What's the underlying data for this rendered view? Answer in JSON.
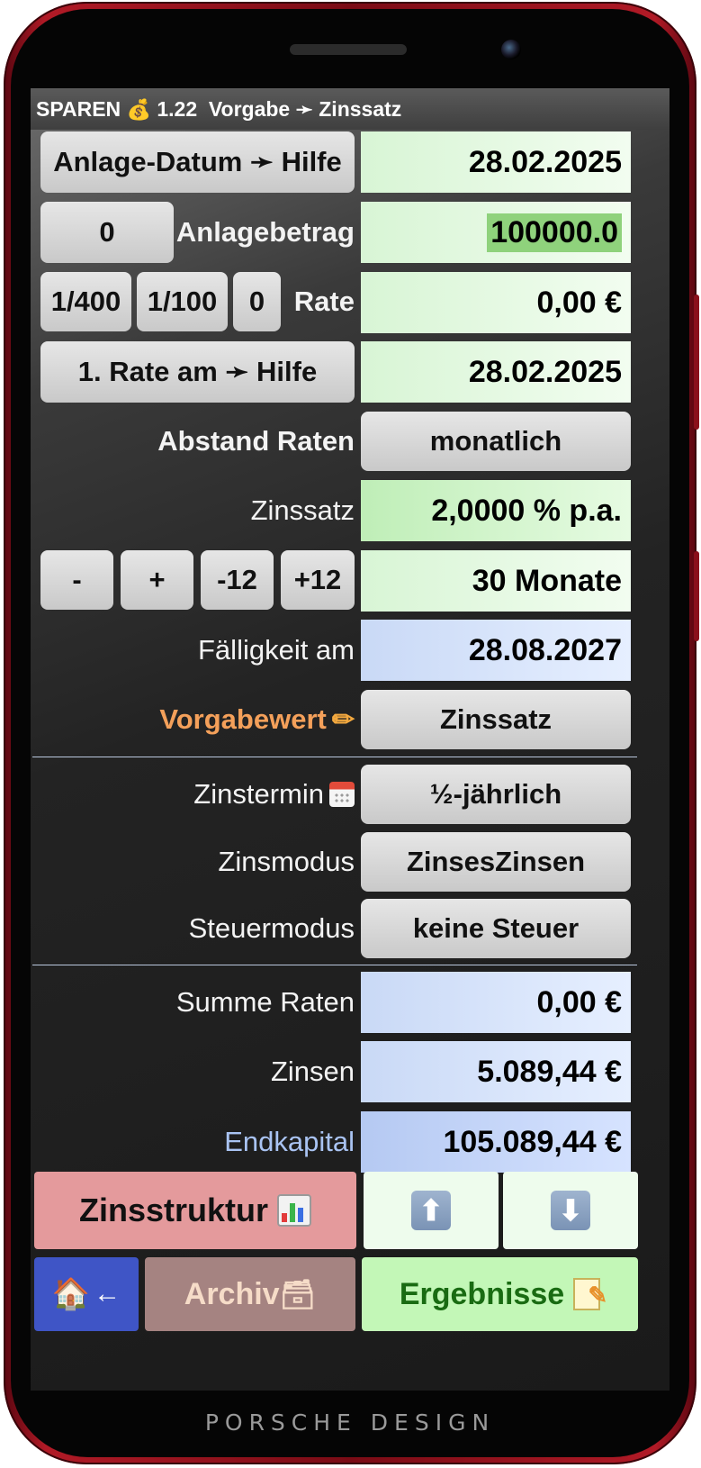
{
  "device": {
    "brand_text": "PORSCHE DESIGN"
  },
  "statusbar": {
    "app": "SPAREN",
    "icon": "money-bag-icon",
    "version": "1.22",
    "mode": "Vorgabe ➛ Zinssatz"
  },
  "rows": {
    "anlage_datum": {
      "button": "Anlage-Datum ➛ Hilfe",
      "value": "28.02.2025"
    },
    "anlagebetrag": {
      "button": "0",
      "label": "Anlagebetrag",
      "value": "100000.0"
    },
    "rate": {
      "btn_a": "1/400",
      "btn_b": "1/100",
      "btn_c": "0",
      "label": "Rate",
      "value": "0,00 €"
    },
    "erste_rate": {
      "button": "1. Rate am ➛ Hilfe",
      "value": "28.02.2025"
    },
    "abstand": {
      "label": "Abstand Raten",
      "value": "monatlich"
    },
    "zinssatz": {
      "label": "Zinssatz",
      "value": "2,0000 % p.a."
    },
    "laufzeit": {
      "minus": "-",
      "plus": "+",
      "minus12": "-12",
      "plus12": "+12",
      "value": "30 Monate"
    },
    "faelligkeit": {
      "label": "Fälligkeit am",
      "value": "28.08.2027"
    },
    "vorgabewert": {
      "label": "Vorgabewert",
      "value": "Zinssatz"
    },
    "zinstermin": {
      "label": "Zinstermin",
      "value": "½-jährlich"
    },
    "zinsmodus": {
      "label": "Zinsmodus",
      "value": "ZinsesZinsen"
    },
    "steuermodus": {
      "label": "Steuermodus",
      "value": "keine Steuer"
    },
    "summe_raten": {
      "label": "Summe Raten",
      "value": "0,00 €"
    },
    "zinsen": {
      "label": "Zinsen",
      "value": "5.089,44 €"
    },
    "endkapital": {
      "label": "Endkapital",
      "value": "105.089,44 €"
    }
  },
  "bottom": {
    "zinsstruktur": "Zinsstruktur",
    "up_icon": "up-arrow-icon",
    "down_icon": "down-arrow-icon",
    "home_arrow": "←",
    "archiv": "Archiv",
    "ergebnisse": "Ergebnisse"
  },
  "colors": {
    "label_orange": "#f4a05a",
    "label_blue": "#a9c3f2",
    "zinsstruktur_bg": "#e49a9c",
    "home_bg": "#3f55c6",
    "archiv_bg": "#a58381",
    "ergebnisse_bg": "#c3f7b7",
    "ergebnisse_text": "#196b12"
  }
}
